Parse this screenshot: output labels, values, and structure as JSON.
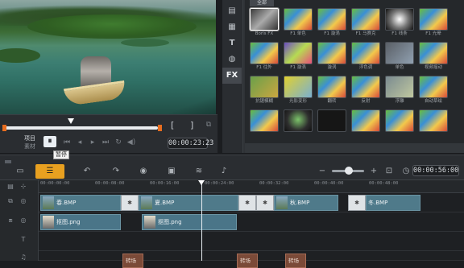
{
  "preview": {
    "project_label": "项目",
    "clip_label": "素材",
    "play_tooltip": "暂停",
    "play_glyph": "⏸",
    "timecode": "00:00:23:23",
    "mark_in": "[",
    "mark_out": "]"
  },
  "library": {
    "tabs": [
      {
        "icon": "media-icon",
        "glyph": "▤"
      },
      {
        "icon": "instant-project-icon",
        "glyph": "▦"
      },
      {
        "icon": "title-icon",
        "glyph": "T"
      },
      {
        "icon": "graphics-icon",
        "glyph": "◍"
      },
      {
        "icon": "fx-icon",
        "glyph": "FX"
      }
    ],
    "header_chip": "全部",
    "items": [
      {
        "label": "Boris FX"
      },
      {
        "label": "F1 单色"
      },
      {
        "label": "F1 漩涡"
      },
      {
        "label": "F1 马赛克"
      },
      {
        "label": "F1 线条"
      },
      {
        "label": "F1 光晕"
      },
      {
        "label": "F1 往外"
      },
      {
        "label": "F1 漩涡"
      },
      {
        "label": "漩涡"
      },
      {
        "label": "浮色调"
      },
      {
        "label": "单色"
      },
      {
        "label": "视频摇动"
      },
      {
        "label": "抗锯模糊"
      },
      {
        "label": "光影变形"
      },
      {
        "label": "翻转"
      },
      {
        "label": "反射"
      },
      {
        "label": "浮雕"
      },
      {
        "label": "自动草绘"
      },
      {
        "label": ""
      },
      {
        "label": ""
      },
      {
        "label": ""
      },
      {
        "label": ""
      },
      {
        "label": ""
      },
      {
        "label": ""
      }
    ]
  },
  "toolbar": {
    "timecode": "00:00:56:00",
    "zoom_out": "−",
    "zoom_in": "+"
  },
  "ruler": {
    "ticks": [
      "00:00:00:00",
      "00:00:08:00",
      "00:00:16:00",
      "00:00:24:00",
      "00:00:32:00",
      "00:00:40:00",
      "00:00:48:00"
    ]
  },
  "tracks": {
    "video": [
      {
        "label": "春.BMP"
      },
      {
        "label": "夏.BMP"
      },
      {
        "label": "秋.BMP"
      },
      {
        "label": "冬.BMP"
      }
    ],
    "overlay": [
      {
        "label": "抠图.png"
      },
      {
        "label": "抠图.png"
      }
    ],
    "fx": [
      {
        "label": "转场"
      },
      {
        "label": "转场"
      },
      {
        "label": "转场"
      }
    ]
  }
}
